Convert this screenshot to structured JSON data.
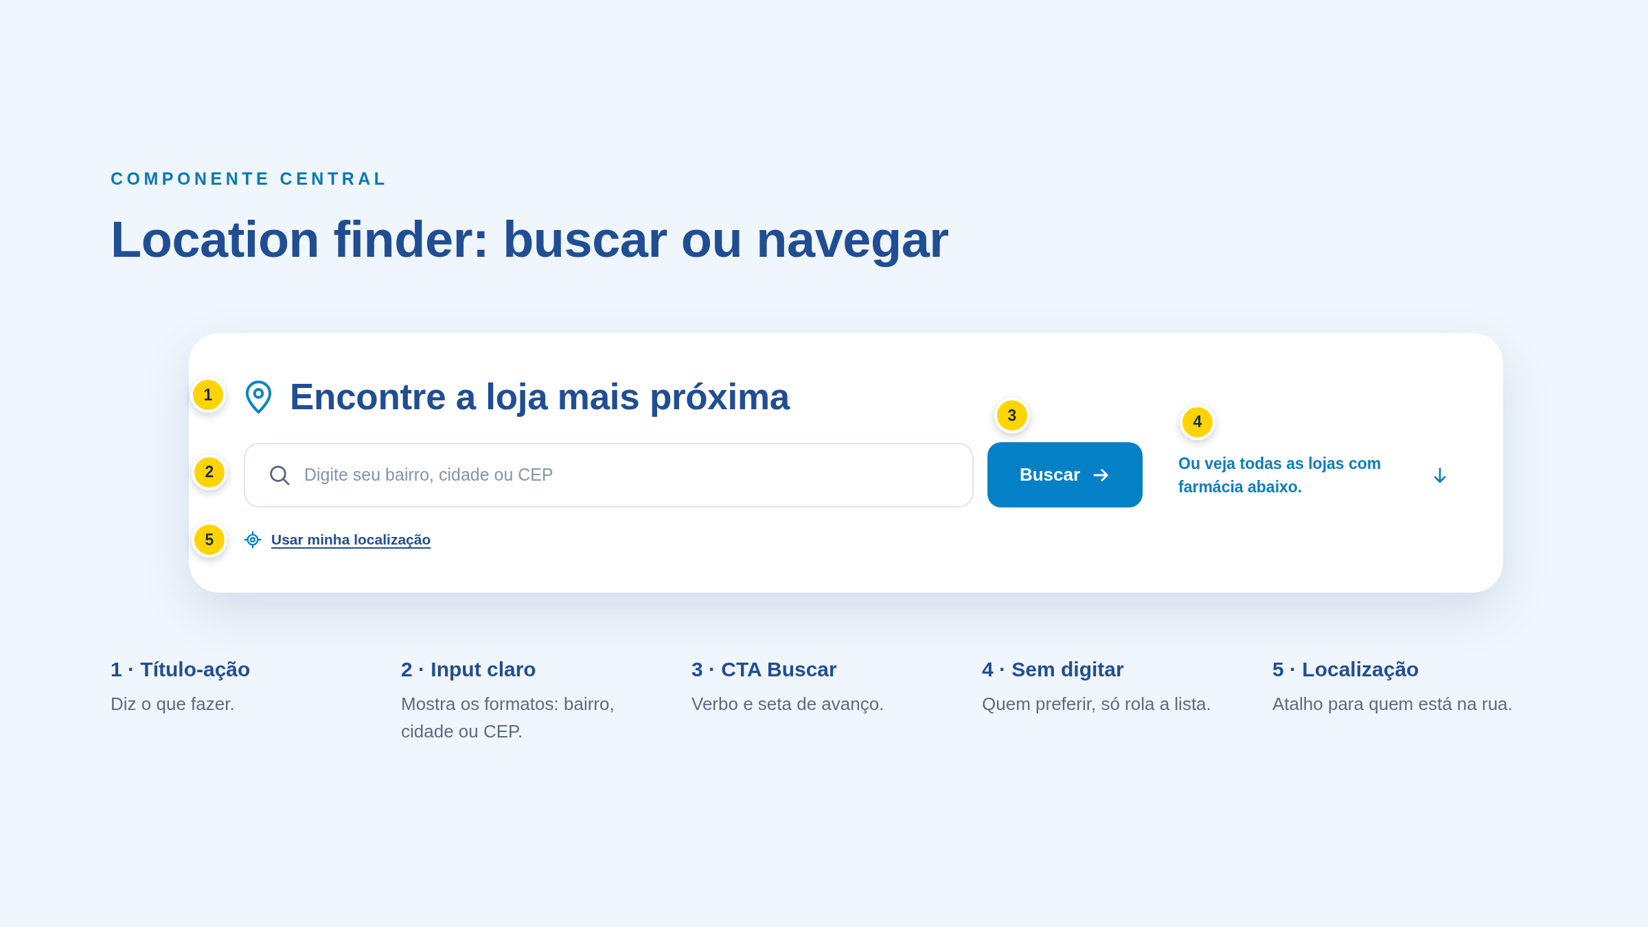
{
  "eyebrow": "COMPONENTE CENTRAL",
  "title": "Location finder: buscar ou navegar",
  "finder_card": {
    "heading": {
      "step": "1",
      "text": "Encontre a loja mais próxima"
    },
    "search_field": {
      "step": "2",
      "placeholder": "Digite seu bairro, cidade ou CEP"
    },
    "search_button": {
      "step": "3",
      "label": "Buscar"
    },
    "browse_link": {
      "step": "4",
      "text": "Ou veja todas as lojas com farmácia abaixo."
    },
    "location_link": {
      "step": "5",
      "text": "Usar minha localização"
    }
  },
  "notes": [
    {
      "heading": "1 · Título-ação",
      "text": "Diz o que fazer."
    },
    {
      "heading": "2 · Input claro",
      "text": "Mostra os formatos: bairro, cidade ou CEP."
    },
    {
      "heading": "3 · CTA Buscar",
      "text": "Verbo e seta de avanço."
    },
    {
      "heading": "4 · Sem digitar",
      "text": "Quem preferir, só rola a lista."
    },
    {
      "heading": "5 · Localização",
      "text": "Atalho para quem está na rua."
    }
  ]
}
